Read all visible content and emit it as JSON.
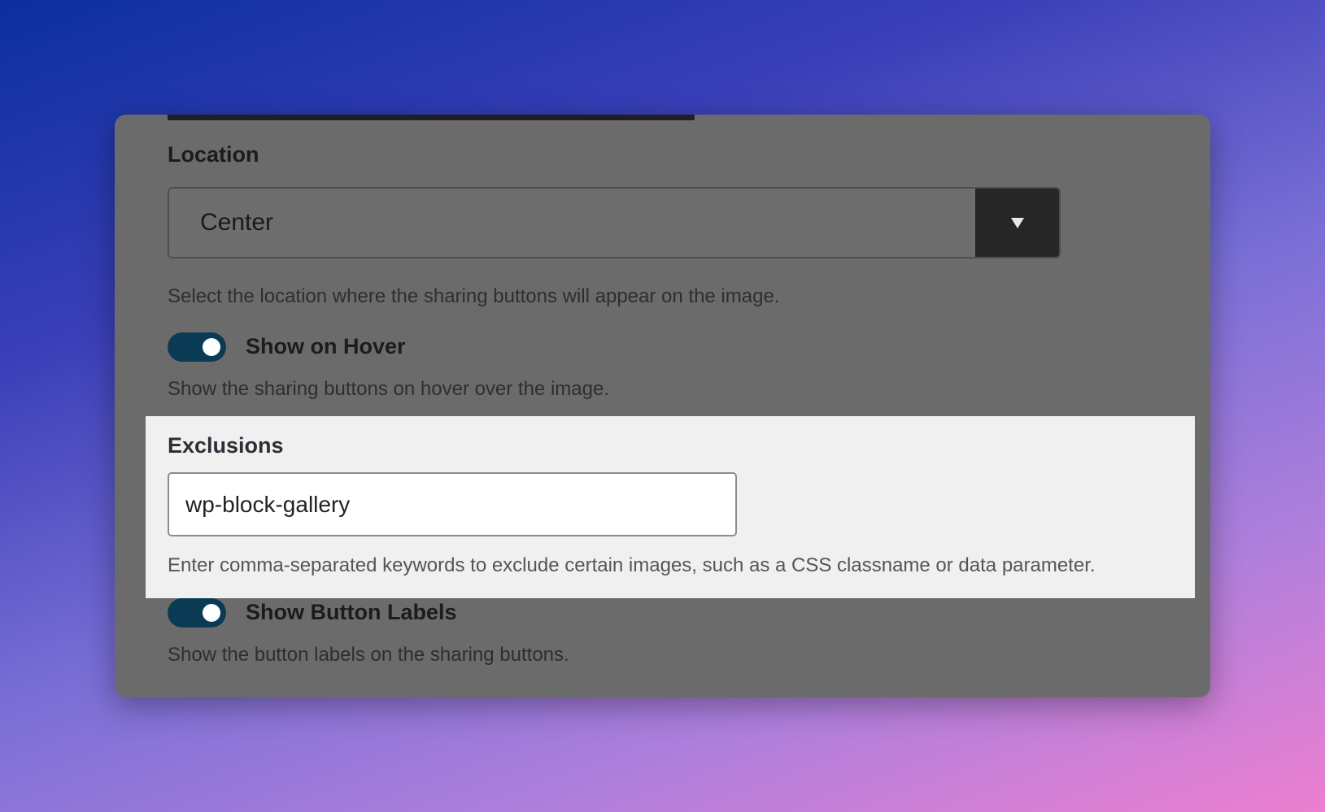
{
  "location": {
    "label": "Location",
    "selected": "Center",
    "help": "Select the location where the sharing buttons will appear on the image."
  },
  "show_on_hover": {
    "label": "Show on Hover",
    "enabled": true,
    "help": "Show the sharing buttons on hover over the image."
  },
  "exclusions": {
    "label": "Exclusions",
    "value": "wp-block-gallery",
    "help": "Enter comma-separated keywords to exclude certain images, such as a CSS classname or data parameter."
  },
  "show_button_labels": {
    "label": "Show Button Labels",
    "enabled": true,
    "help": "Show the button labels on the sharing buttons."
  },
  "colors": {
    "toggle_on": "#0b3a55",
    "panel": "#6b6b6b",
    "highlight": "#f0f0f0"
  },
  "icons": {
    "select_arrow": "triangle-down-icon"
  }
}
